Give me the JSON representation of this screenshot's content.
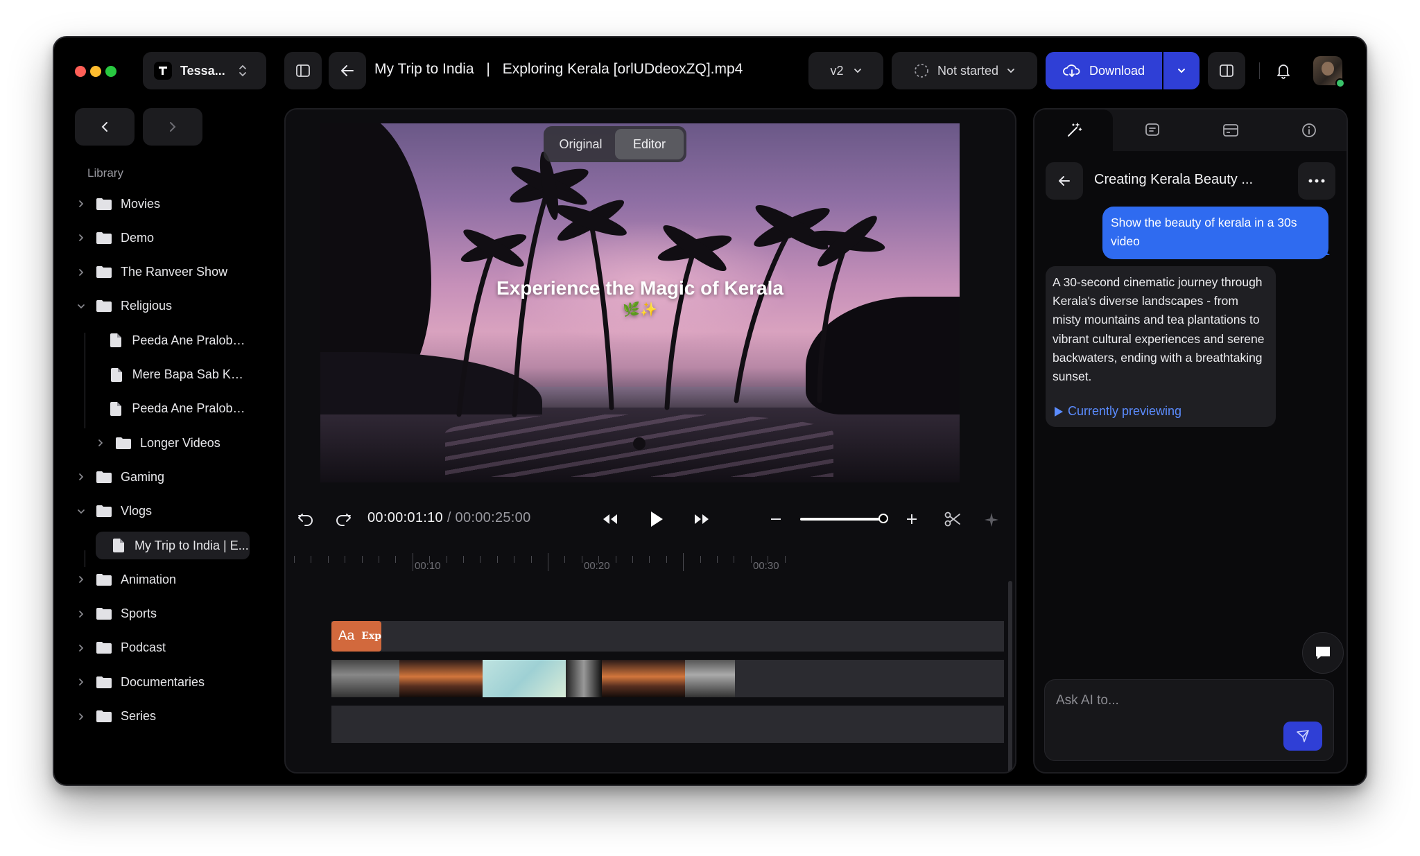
{
  "header": {
    "workspace": "Tessa...",
    "breadcrumb_project": "My Trip to India",
    "breadcrumb_sep": "|",
    "file_name": "Exploring Kerala [orlUDdeoxZQ].mp4",
    "version": "v2",
    "status": "Not started",
    "download_label": "Download"
  },
  "sidebar": {
    "section_label": "Library",
    "items": [
      {
        "label": "Movies",
        "type": "folder",
        "expanded": false
      },
      {
        "label": "Demo",
        "type": "folder",
        "expanded": false
      },
      {
        "label": "The Ranveer Show",
        "type": "folder",
        "expanded": false
      },
      {
        "label": "Religious",
        "type": "folder",
        "expanded": true
      },
      {
        "label": "Peeda Ane Pralobha...",
        "type": "file"
      },
      {
        "label": "Mere Bapa Sab Kuc...",
        "type": "file"
      },
      {
        "label": "Peeda Ane Pralobha...",
        "type": "file"
      },
      {
        "label": "Longer Videos",
        "type": "folder",
        "expanded": false
      },
      {
        "label": "Gaming",
        "type": "folder",
        "expanded": false
      },
      {
        "label": "Vlogs",
        "type": "folder",
        "expanded": true
      },
      {
        "label": "My Trip to India  |  E...",
        "type": "file",
        "selected": true
      },
      {
        "label": "Animation",
        "type": "folder",
        "expanded": false
      },
      {
        "label": "Sports",
        "type": "folder",
        "expanded": false
      },
      {
        "label": "Podcast",
        "type": "folder",
        "expanded": false
      },
      {
        "label": "Documentaries",
        "type": "folder",
        "expanded": false
      },
      {
        "label": "Series",
        "type": "folder",
        "expanded": false
      }
    ]
  },
  "player": {
    "toggle_original": "Original",
    "toggle_editor": "Editor",
    "active_view": "Editor",
    "overlay_title": "Experience the Magic of Kerala",
    "overlay_emoji": "🌿✨",
    "current_time": "00:00:01:10",
    "time_separator": "/",
    "total_time": "00:00:25:00",
    "zoom_level": 0.95
  },
  "timeline": {
    "ruler_labels": [
      "00:10",
      "00:20",
      "00:30"
    ],
    "text_clip_icon": "Aa",
    "text_clip_label": "Exp"
  },
  "chat": {
    "title": "Creating Kerala Beauty ...",
    "user_message": "Show the beauty of kerala in a 30s video",
    "ai_message": "A 30-second cinematic journey through Kerala's diverse landscapes - from misty mountains and tea plantations to vibrant cultural experiences and serene backwaters, ending with a breathtaking sunset.",
    "preview_label": "Currently previewing",
    "input_placeholder": "Ask AI to..."
  },
  "colors": {
    "accent_blue": "#2f6bf0",
    "download_blue": "#2f3fd6",
    "text_clip_orange": "#d2693d",
    "link_blue": "#5b8cff"
  }
}
